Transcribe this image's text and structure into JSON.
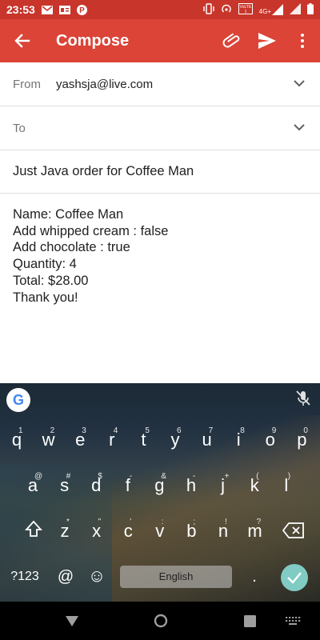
{
  "status_bar": {
    "time": "23:53",
    "icons_left": [
      "gmail-icon",
      "news-icon",
      "pocket-icon"
    ],
    "icons_right": [
      "vibrate-icon",
      "hotspot-icon",
      "volte-icon",
      "4g-signal-icon",
      "wifi-signal-icon",
      "battery-icon"
    ],
    "network_label": "4G+"
  },
  "app_bar": {
    "title": "Compose",
    "color": "#db4437",
    "status_color": "#c8352b"
  },
  "compose": {
    "from_label": "From",
    "from_value": "yashsja@live.com",
    "to_label": "To",
    "to_value": "",
    "subject": "Just Java order for Coffee Man",
    "body_lines": [
      "Name: Coffee Man",
      "Add whipped cream : false",
      "Add chocolate : true",
      "Quantity: 4",
      "Total: $28.00",
      "Thank you!"
    ]
  },
  "keyboard": {
    "row1": [
      {
        "k": "q",
        "h": "1"
      },
      {
        "k": "w",
        "h": "2"
      },
      {
        "k": "e",
        "h": "3"
      },
      {
        "k": "r",
        "h": "4"
      },
      {
        "k": "t",
        "h": "5"
      },
      {
        "k": "y",
        "h": "6"
      },
      {
        "k": "u",
        "h": "7"
      },
      {
        "k": "i",
        "h": "8"
      },
      {
        "k": "o",
        "h": "9"
      },
      {
        "k": "p",
        "h": "0"
      }
    ],
    "row2": [
      {
        "k": "a",
        "h": "@"
      },
      {
        "k": "s",
        "h": "#"
      },
      {
        "k": "d",
        "h": "$"
      },
      {
        "k": "f",
        "h": "-"
      },
      {
        "k": "g",
        "h": "&"
      },
      {
        "k": "h",
        "h": "-"
      },
      {
        "k": "j",
        "h": "+"
      },
      {
        "k": "k",
        "h": "("
      },
      {
        "k": "l",
        "h": ")"
      }
    ],
    "row3": [
      {
        "k": "z",
        "h": "*"
      },
      {
        "k": "x",
        "h": "\""
      },
      {
        "k": "c",
        "h": "'"
      },
      {
        "k": "v",
        "h": ":"
      },
      {
        "k": "b",
        "h": ";"
      },
      {
        "k": "n",
        "h": "!"
      },
      {
        "k": "m",
        "h": "?"
      }
    ],
    "symbols_key": "?123",
    "at_key": "@",
    "emoji_key": "☺",
    "space_label": "English",
    "period_key": ".",
    "google_logo": "G"
  }
}
